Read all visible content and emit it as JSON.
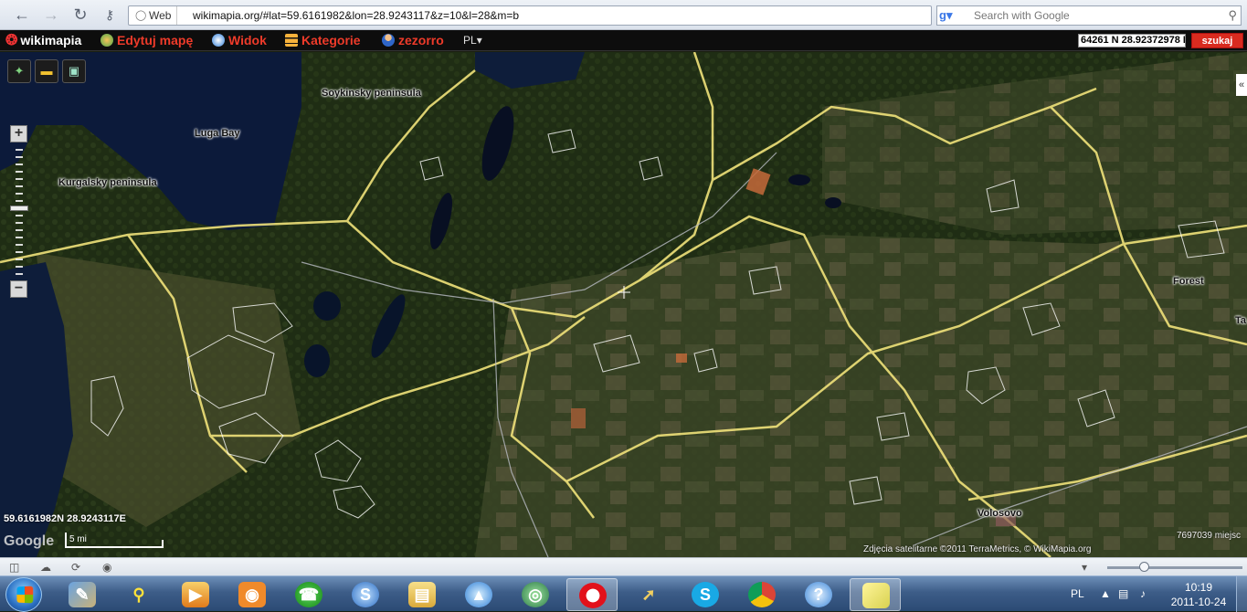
{
  "browser": {
    "nav_icons": [
      "back-arrow-icon",
      "forward-arrow-icon",
      "reload-icon",
      "key-icon"
    ],
    "site_label": "Web",
    "url": "wikimapia.org/#lat=59.6161982&lon=28.9243117&z=10&l=28&m=b",
    "search_engine_icon": "google-icon",
    "search_placeholder": "Search with Google"
  },
  "wikimapia": {
    "logo": "wikimapia",
    "menu": [
      {
        "label": "Edytuj mapę",
        "icon": "edit-map-icon"
      },
      {
        "label": "Widok",
        "icon": "compass-icon"
      },
      {
        "label": "Kategorie",
        "icon": "categories-icon"
      },
      {
        "label": "zezorro",
        "icon": "user-icon"
      }
    ],
    "language": "PL",
    "coord_input": "64261 N 28.92372978 E",
    "search_button": "szukaj"
  },
  "map": {
    "labels": [
      {
        "text": "Soykinsky peninsula"
      },
      {
        "text": "Luga Bay"
      },
      {
        "text": "Kurgalsky peninsula"
      },
      {
        "text": "Forest"
      },
      {
        "text": "Volosovo"
      },
      {
        "text": "Ta"
      }
    ],
    "cursor_coordinates": "59.6161982N 28.9243117E",
    "scale_label": "5 mi",
    "provider_logo": "Google",
    "attribution": "Zdjęcia satelitarne ©2011 TerraMetrics, © WikiMapia.org",
    "object_counter": "7697039 miejsc",
    "colors": {
      "roads": "#f0e27a",
      "outlines": "#ffffff",
      "water": "#0c1a3a",
      "accent": "#d92b1f"
    }
  },
  "statusbar": {
    "icons": [
      "panel-icon",
      "cloud-icon",
      "share-icon",
      "speed-dial-icon"
    ],
    "zoom_level_fraction": 0.28
  },
  "taskbar": {
    "apps": [
      {
        "name": "start-button"
      },
      {
        "name": "task-manager-icon"
      },
      {
        "name": "pin-icon"
      },
      {
        "name": "media-player-icon"
      },
      {
        "name": "eye-icon"
      },
      {
        "name": "phone-icon"
      },
      {
        "name": "network-icon"
      },
      {
        "name": "folder-icon"
      },
      {
        "name": "paint-icon"
      },
      {
        "name": "globe-icon"
      },
      {
        "name": "opera-icon"
      },
      {
        "name": "telescope-icon"
      },
      {
        "name": "skype-icon"
      },
      {
        "name": "chrome-icon"
      },
      {
        "name": "messenger-icon"
      },
      {
        "name": "sticky-notes-icon"
      }
    ],
    "active_app": "opera-icon",
    "tray_language": "PL",
    "time": "10:19",
    "date": "2011-10-24"
  }
}
